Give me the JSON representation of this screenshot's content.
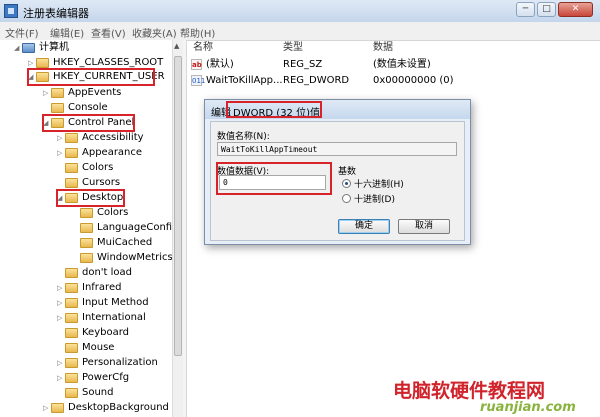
{
  "window": {
    "title": "注册表编辑器",
    "controls": [
      "─",
      "□",
      "✕"
    ]
  },
  "menu": [
    "文件(F)",
    "编辑(E)",
    "查看(V)",
    "收藏夹(A)",
    "帮助(H)"
  ],
  "tree": [
    {
      "label": "计算机",
      "expander": "◢"
    },
    {
      "label": "HKEY_CLASSES_ROOT",
      "expander": "▷"
    },
    {
      "label": "HKEY_CURRENT_USER",
      "expander": "◢"
    },
    {
      "label": "AppEvents",
      "expander": "▷"
    },
    {
      "label": "Console",
      "expander": ""
    },
    {
      "label": "Control Panel",
      "expander": "◢"
    },
    {
      "label": "Accessibility",
      "expander": "▷"
    },
    {
      "label": "Appearance",
      "expander": "▷"
    },
    {
      "label": "Colors",
      "expander": ""
    },
    {
      "label": "Cursors",
      "expander": ""
    },
    {
      "label": "Desktop",
      "expander": "◢"
    },
    {
      "label": "Colors",
      "expander": ""
    },
    {
      "label": "LanguageConfig",
      "expander": ""
    },
    {
      "label": "MuiCached",
      "expander": ""
    },
    {
      "label": "WindowMetrics",
      "expander": ""
    },
    {
      "label": "don't load",
      "expander": ""
    },
    {
      "label": "Infrared",
      "expander": "▷"
    },
    {
      "label": "Input Method",
      "expander": "▷"
    },
    {
      "label": "International",
      "expander": "▷"
    },
    {
      "label": "Keyboard",
      "expander": ""
    },
    {
      "label": "Mouse",
      "expander": ""
    },
    {
      "label": "Personalization",
      "expander": "▷"
    },
    {
      "label": "PowerCfg",
      "expander": "▷"
    },
    {
      "label": "Sound",
      "expander": ""
    },
    {
      "label": "DesktopBackground",
      "expander": "▷"
    }
  ],
  "list": {
    "headers": [
      "名称",
      "类型",
      "数据"
    ],
    "rows": [
      {
        "icon": "ab",
        "name": "(默认)",
        "type": "REG_SZ",
        "data": "(数值未设置)"
      },
      {
        "icon": "011",
        "name": "WaitToKillApp...",
        "type": "REG_DWORD",
        "data": "0x00000000 (0)"
      }
    ]
  },
  "dialog": {
    "title_prefix": "编辑",
    "title_main": "DWORD (32 位)值",
    "name_label": "数值名称(N):",
    "name_value": "WaitToKillAppTimeout",
    "data_label": "数值数据(V):",
    "data_value": "0",
    "base_label": "基数",
    "hex_label": "十六进制(H)",
    "dec_label": "十进制(D)",
    "ok": "确定",
    "cancel": "取消"
  },
  "watermark": {
    "text": "电脑软硬件教程网",
    "url_text": "ruanjian.com"
  },
  "colors": {
    "highlight": "#d9232b",
    "watermark": "#d0232b"
  }
}
